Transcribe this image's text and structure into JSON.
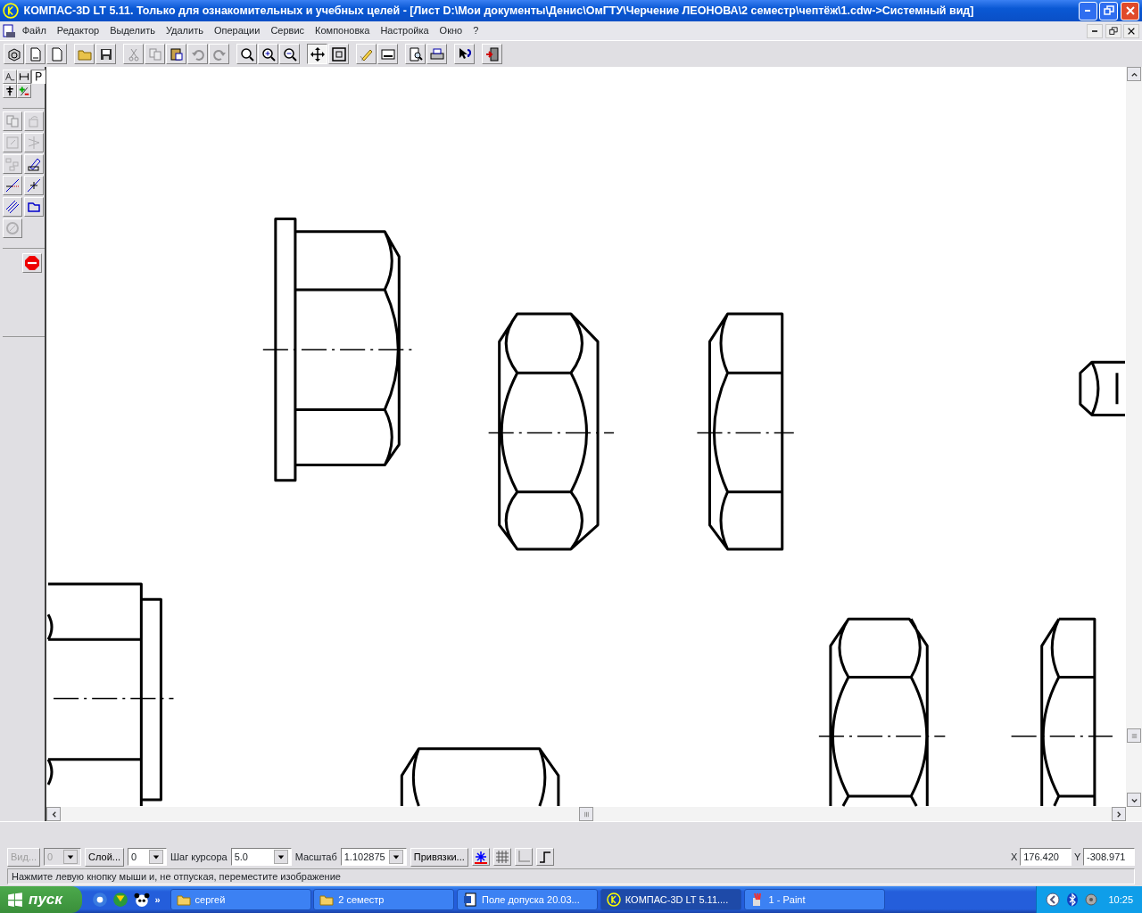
{
  "window": {
    "title": "КОМПАС-3D LT 5.11. Только для ознакомительных и учебных целей - [Лист D:\\Мои документы\\Денис\\ОмГТУ\\Черчение  ЛЕОНОВА\\2 семестр\\чептёж\\1.cdw->Системный вид]"
  },
  "menu": [
    "Файл",
    "Редактор",
    "Выделить",
    "Удалить",
    "Операции",
    "Сервис",
    "Компоновка",
    "Настройка",
    "Окно",
    "?"
  ],
  "toolbar": [
    {
      "kind": "model",
      "disabled": false,
      "selected": false
    },
    {
      "kind": "sheet",
      "disabled": false,
      "selected": false
    },
    {
      "kind": "fragment",
      "disabled": false,
      "selected": false
    },
    {
      "kind": "open",
      "disabled": false,
      "selected": false
    },
    {
      "kind": "save",
      "disabled": false,
      "selected": false
    },
    {
      "kind": "cut",
      "disabled": true,
      "selected": false
    },
    {
      "kind": "copy",
      "disabled": true,
      "selected": false
    },
    {
      "kind": "paste",
      "disabled": false,
      "selected": false
    },
    {
      "kind": "undo",
      "disabled": true,
      "selected": false
    },
    {
      "kind": "redo",
      "disabled": true,
      "selected": false
    },
    {
      "kind": "zoom",
      "disabled": false,
      "selected": false
    },
    {
      "kind": "zoom-in",
      "disabled": false,
      "selected": false
    },
    {
      "kind": "zoom-out",
      "disabled": false,
      "selected": false
    },
    {
      "kind": "pan",
      "disabled": false,
      "selected": true
    },
    {
      "kind": "fit",
      "disabled": false,
      "selected": false
    },
    {
      "kind": "pen",
      "disabled": false,
      "selected": false
    },
    {
      "kind": "panel",
      "disabled": false,
      "selected": false
    },
    {
      "kind": "preview",
      "disabled": false,
      "selected": false
    },
    {
      "kind": "print",
      "disabled": false,
      "selected": false
    },
    {
      "kind": "help",
      "disabled": false,
      "selected": false
    },
    {
      "kind": "exit",
      "disabled": false,
      "selected": false
    }
  ],
  "left_panel": {
    "tabs": [
      {
        "kind": "text",
        "selected": false
      },
      {
        "kind": "dimension",
        "selected": false
      },
      {
        "kind": "param",
        "selected": true
      },
      {
        "kind": "symbol",
        "selected": false
      },
      {
        "kind": "edit",
        "selected": false
      }
    ],
    "tools": [
      {
        "kind": "copy",
        "disabled": true
      },
      {
        "kind": "rotate",
        "disabled": true
      },
      {
        "kind": "scale",
        "disabled": true
      },
      {
        "kind": "mirror",
        "disabled": true
      },
      {
        "kind": "array",
        "disabled": true
      },
      {
        "kind": "deform",
        "disabled": false
      },
      {
        "kind": "trim",
        "disabled": false
      },
      {
        "kind": "break",
        "disabled": false
      },
      {
        "kind": "hatch",
        "disabled": false
      },
      {
        "kind": "move",
        "disabled": false
      },
      {
        "kind": "round",
        "disabled": true
      }
    ]
  },
  "bottom_bar": {
    "view_button": {
      "label": "Вид...",
      "disabled": true
    },
    "view_field": {
      "value": "0",
      "disabled": true
    },
    "layer_button": "Слой...",
    "layer_field": "0",
    "step_label": "Шаг курсора",
    "step_field": "5.0",
    "scale_label": "Масштаб",
    "scale_field": "1.102875",
    "snap_button": "Привязки...",
    "x_label": "X",
    "x_value": "176.420",
    "y_label": "Y",
    "y_value": "-308.971"
  },
  "status_bar": "Нажмите левую кнопку мыши и, не отпуская, переместите изображение",
  "taskbar": {
    "start": "пуск",
    "more": "»",
    "tasks": [
      {
        "kind": "folder",
        "label": "сергей",
        "selected": false
      },
      {
        "kind": "folder",
        "label": "2 семестр",
        "selected": false
      },
      {
        "kind": "word",
        "label": "Поле допуска 20.03...",
        "selected": false
      },
      {
        "kind": "kompas",
        "label": "КОМПАС-3D LT 5.11....",
        "selected": true
      },
      {
        "kind": "paint",
        "label": "1 - Paint",
        "selected": false
      }
    ],
    "clock": "10:25"
  }
}
